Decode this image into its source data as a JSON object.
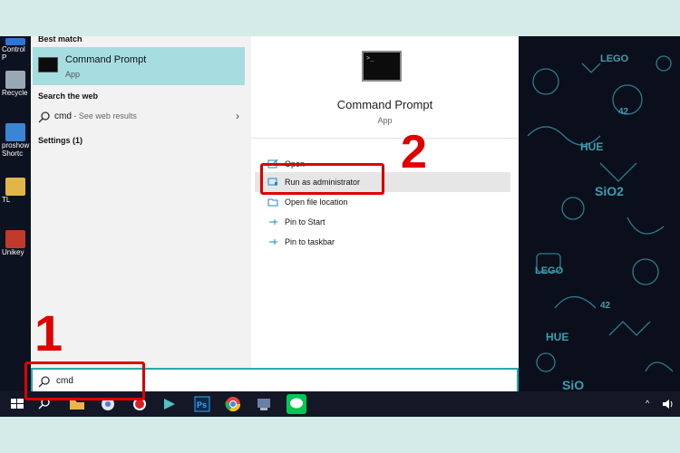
{
  "desktop": {
    "icons": [
      {
        "label": "Control P",
        "color": "#2c77d6"
      },
      {
        "label": "Recycle",
        "color": "#9aa7b5"
      },
      {
        "label": "proshow Shortc",
        "color": "#3a86d4"
      },
      {
        "label": "TL",
        "color": "#e2b54a"
      },
      {
        "label": "Unikey",
        "color": "#c0392b"
      }
    ],
    "wallpaper_words": [
      "LEGO",
      "HUE",
      "42",
      "SiO2",
      "LEGO",
      "42",
      "HUE",
      "SiO"
    ]
  },
  "start_menu": {
    "best_match_heading": "Best match",
    "best_match": {
      "title": "Command Prompt",
      "subtitle": "App",
      "icon": "cmd-icon"
    },
    "web_heading": "Search the web",
    "web_item": {
      "query": "cmd",
      "suffix": " - See web results"
    },
    "settings_heading": "Settings (1)"
  },
  "detail": {
    "title": "Command Prompt",
    "subtitle": "App",
    "prompt_glyph": ">_",
    "actions": [
      {
        "label": "Open",
        "icon": "open-icon"
      },
      {
        "label": "Run as administrator",
        "icon": "shield-icon"
      },
      {
        "label": "Open file location",
        "icon": "folder-icon"
      },
      {
        "label": "Pin to Start",
        "icon": "pin-icon"
      },
      {
        "label": "Pin to taskbar",
        "icon": "pin-icon"
      }
    ]
  },
  "search": {
    "value": "cmd"
  },
  "annotations": {
    "step1": "1",
    "step2": "2",
    "color": "#e00000"
  },
  "colors": {
    "accent": "#2aa6ad",
    "highlight": "#a6dde0"
  }
}
